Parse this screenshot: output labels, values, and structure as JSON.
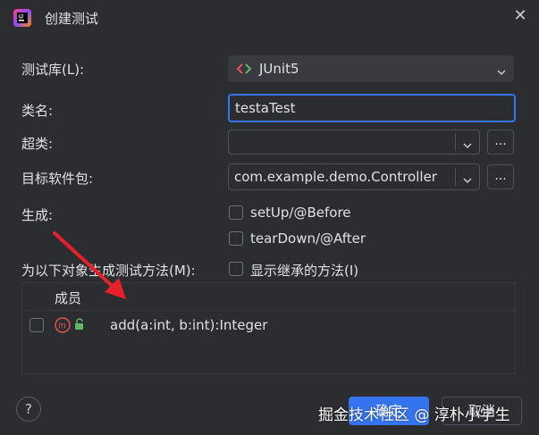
{
  "window": {
    "title": "创建测试",
    "close_icon": "close-icon"
  },
  "form": {
    "library_label": "测试库(L):",
    "library_value": "JUnit5",
    "class_name_label": "类名:",
    "class_name_value": "testaTest",
    "superclass_label": "超类:",
    "superclass_value": "",
    "package_label": "目标软件包:",
    "package_value": "com.example.demo.Controller",
    "browse_label": "...",
    "generate_label": "生成:",
    "setup_label": "setUp/@Before",
    "teardown_label": "tearDown/@After",
    "members_label": "为以下对象生成测试方法(M):",
    "show_inherited_label": "显示继承的方法(I)"
  },
  "table": {
    "header": "成员",
    "rows": [
      {
        "method": "add(a:int, b:int):Integer",
        "badge": "m"
      }
    ]
  },
  "footer": {
    "help_label": "?",
    "ok_label": "确定",
    "cancel_label": "取消"
  },
  "watermark": "掘金技术社区 @ 淳朴小学生",
  "colors": {
    "accent": "#3574f0",
    "background": "#2b2d30",
    "annotation_arrow": "#e8202a",
    "method_badge": "#e05555"
  }
}
